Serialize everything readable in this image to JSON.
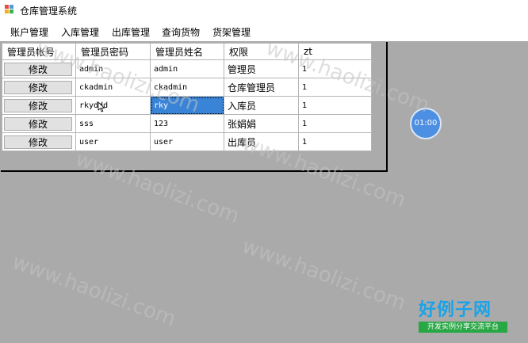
{
  "window": {
    "title": "仓库管理系统"
  },
  "menu": [
    "账户管理",
    "入库管理",
    "出库管理",
    "查询货物",
    "货架管理"
  ],
  "grid": {
    "headers": [
      "管理员帐号",
      "管理员密码",
      "管理员姓名",
      "权限",
      "zt"
    ],
    "button_label": "修改",
    "rows": [
      {
        "account": "admin",
        "name": "admin",
        "role": "管理员",
        "zt": "1"
      },
      {
        "account": "ckadmin",
        "name": "ckadmin",
        "role": "仓库管理员",
        "zt": "1"
      },
      {
        "account": "rkyddd",
        "name": "rky",
        "role": "入库员",
        "zt": "1"
      },
      {
        "account": "sss",
        "name": "123",
        "role": "张娟娟",
        "zt": "1"
      },
      {
        "account": "user",
        "name": "user",
        "role": "出库员",
        "zt": "1"
      }
    ],
    "selected": {
      "row": 2,
      "column": "name"
    }
  },
  "timer": {
    "text": "01:00"
  },
  "watermark": {
    "text": "www.haolizi.com"
  },
  "logo": {
    "title": "好例子网",
    "subtitle": "开发实例分享交流平台"
  },
  "colors": {
    "selection": "#3a84d8",
    "timer": "#4d8fe2",
    "logo_title": "#1aa3e8",
    "logo_sub": "#28a745"
  }
}
